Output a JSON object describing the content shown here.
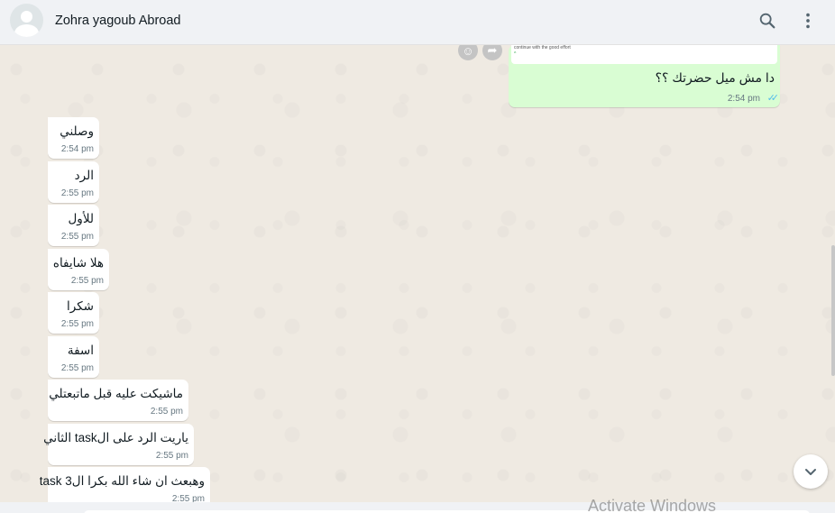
{
  "header": {
    "contact_name": "Zohra yagoub Abroad",
    "icons": [
      "avatar-placeholder",
      "search-icon",
      "menu-kebab-icon"
    ]
  },
  "outgoing": {
    "image_caption": "continue with the good effort",
    "image_mark": "^",
    "text": "دا مش ميل حضرتك ؟؟",
    "time": "2:54 pm",
    "ticks": "✓✓",
    "status_color": "#53bdeb"
  },
  "actions": {
    "react_glyph": "☺",
    "forward_glyph": "➦"
  },
  "incoming": [
    {
      "text": "وصلني",
      "time": "2:54 pm"
    },
    {
      "text": "الرد",
      "time": "2:55 pm"
    },
    {
      "text": "للأول",
      "time": "2:55 pm"
    },
    {
      "text": "هلا شايفاه",
      "time": "2:55 pm"
    },
    {
      "text": "شكرا",
      "time": "2:55 pm"
    },
    {
      "text": "اسفة",
      "time": "2:55 pm"
    },
    {
      "text": "ماشيكت عليه قبل ماتبعتلي",
      "time": "2:55 pm"
    },
    {
      "text": "ياريت الرد على الtask الثاني",
      "time": "2:55 pm"
    },
    {
      "text": "وهبعث ان شاء الله بكرا الtask 3",
      "time": "2:55 pm"
    }
  ],
  "watermark": "Activate Windows",
  "colors": {
    "outgoing_bubble": "#d9fdd3",
    "incoming_bubble": "#ffffff",
    "chat_background": "#efeae2",
    "header_background": "#f0f2f5"
  }
}
